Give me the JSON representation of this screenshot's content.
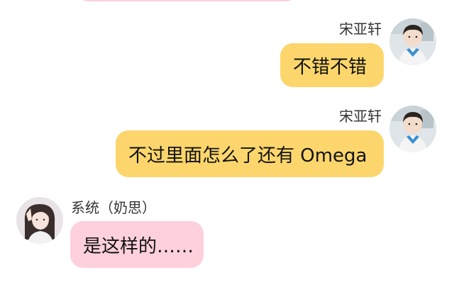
{
  "chat": {
    "messages": [
      {
        "sender": "宋亚轩",
        "text": "不错不错",
        "side": "right",
        "bubble_color": "#fcd66c"
      },
      {
        "sender": "宋亚轩",
        "text": "不过里面怎么了还有 Omega",
        "side": "right",
        "bubble_color": "#fcd66c"
      },
      {
        "sender": "系统（奶思）",
        "text": "是这样的……",
        "side": "left",
        "bubble_color": "#fdd0dc"
      }
    ]
  },
  "icons": {
    "right_avatar": "boy-avatar-icon",
    "left_avatar": "girl-avatar-icon"
  }
}
